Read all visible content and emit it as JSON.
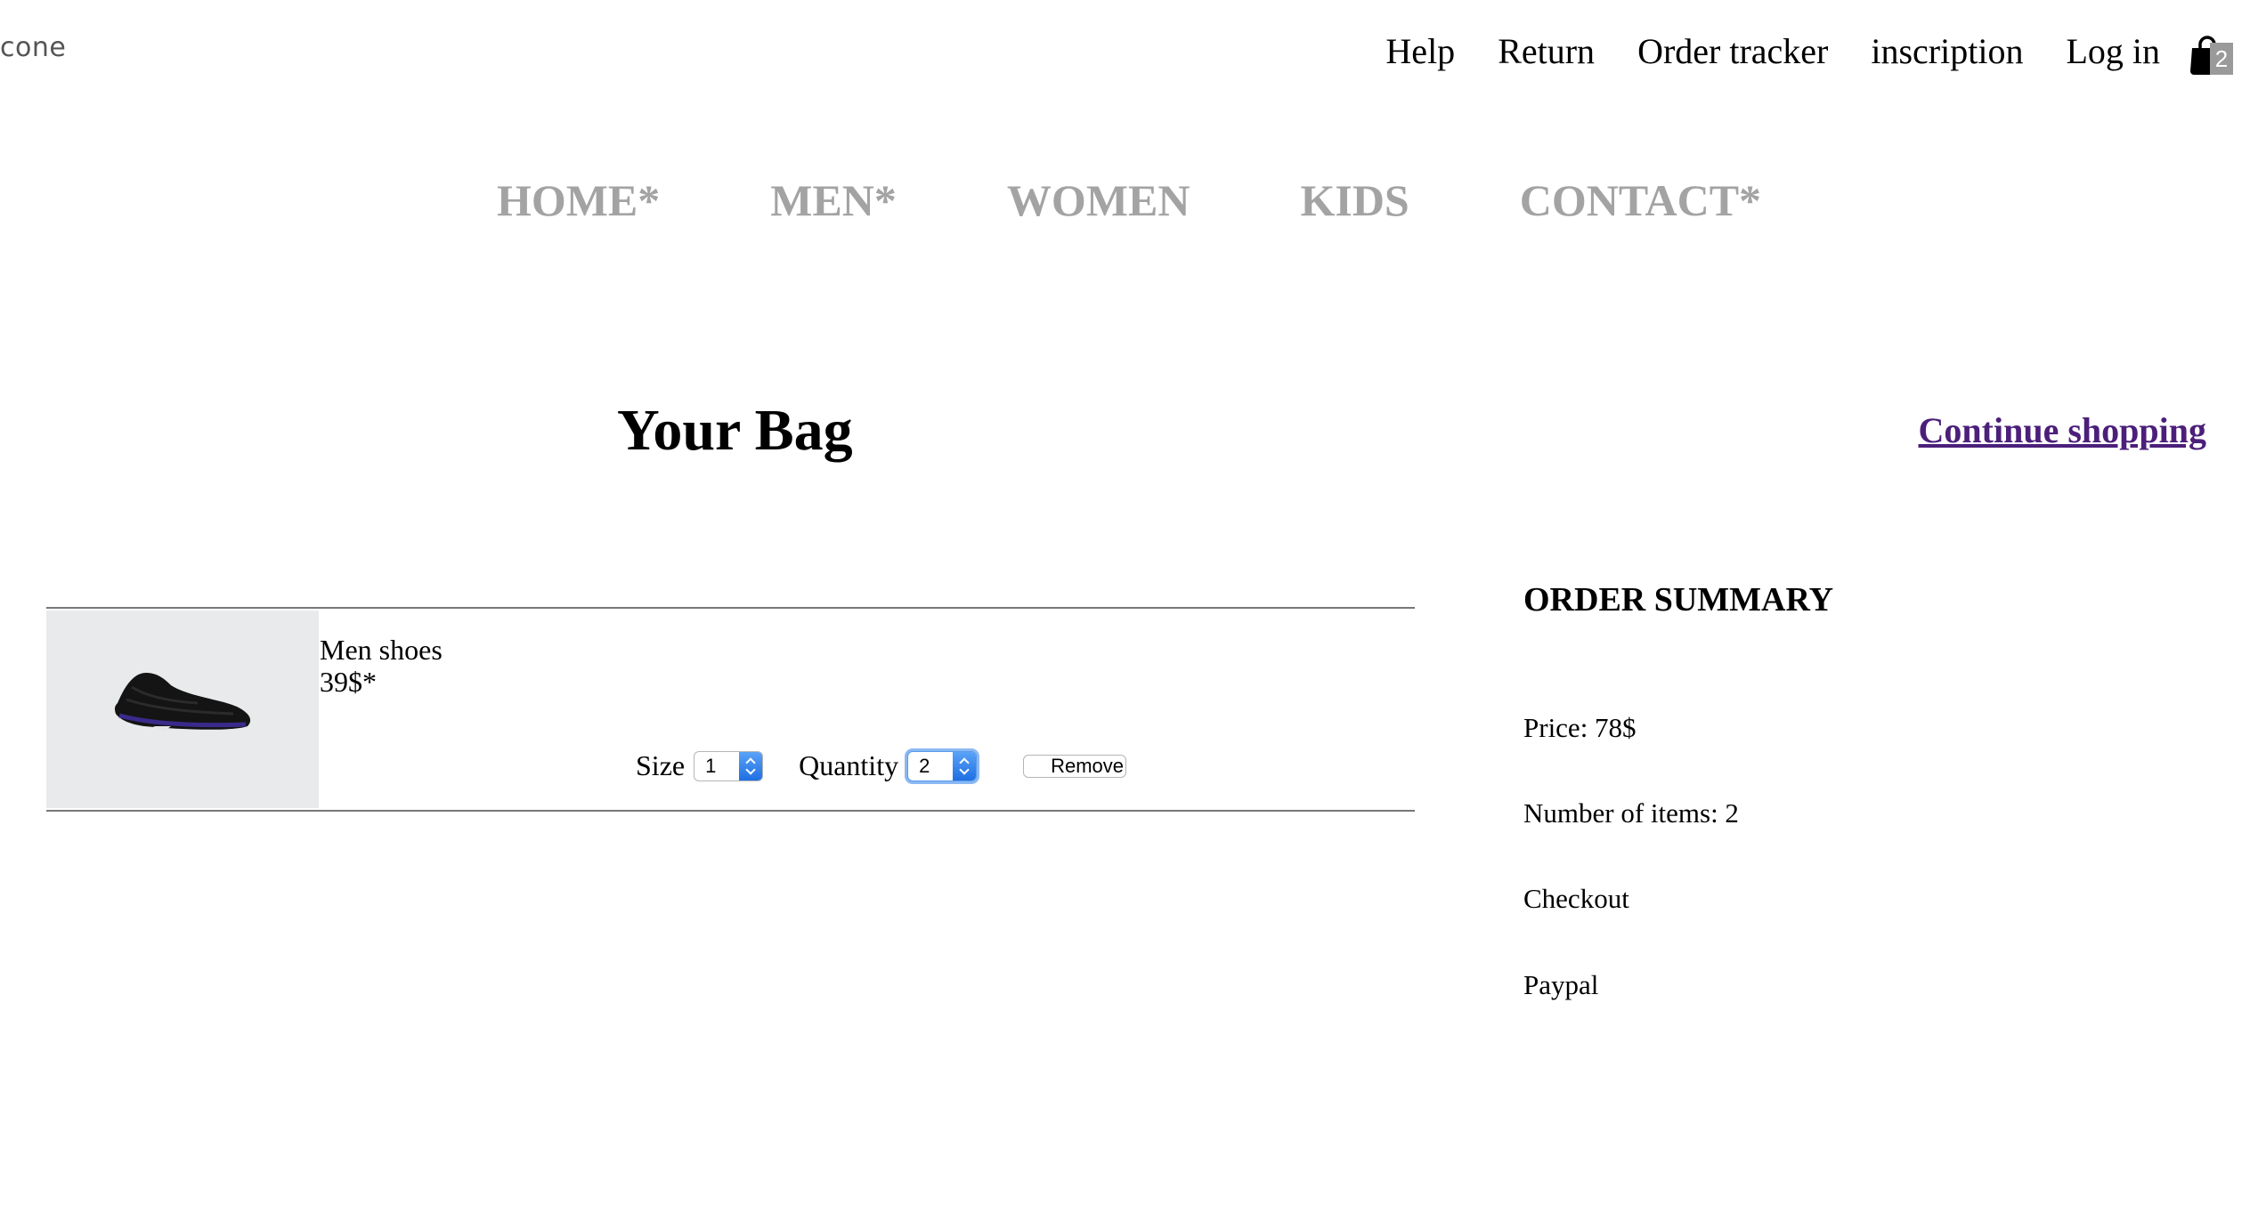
{
  "brand": {
    "logo_text": "cone"
  },
  "top_nav": {
    "links": [
      "Help",
      "Return",
      "Order tracker",
      "inscription",
      "Log in"
    ],
    "cart_count": "2"
  },
  "main_nav": {
    "items": [
      "HOME*",
      "MEN*",
      "WOMEN",
      "KIDS",
      "CONTACT*"
    ]
  },
  "page": {
    "title": "Your Bag",
    "continue_link": "Continue shopping"
  },
  "cart": {
    "items": [
      {
        "name": "Men shoes",
        "price": "39$*",
        "size_label": "Size",
        "size_value": "1",
        "quantity_label": "Quantity",
        "quantity_value": "2",
        "remove_label": "Remove"
      }
    ]
  },
  "summary": {
    "title": "ORDER SUMMARY",
    "price_text": "Price: 78$",
    "items_text": "Number of items: 2",
    "checkout_text": "Checkout",
    "paypal_text": "Paypal"
  },
  "colors": {
    "nav_grey": "#a3a3a3",
    "link_visited": "#4b1f7a",
    "select_accent": "#1f6fe3",
    "product_bg": "#e8eaeb"
  }
}
